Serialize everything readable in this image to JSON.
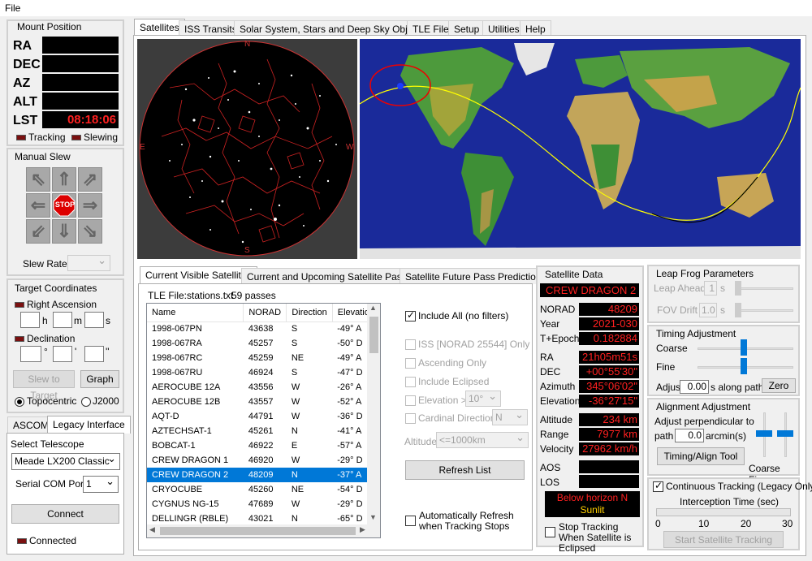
{
  "menu": {
    "file": "File"
  },
  "mount": {
    "title": "Mount Position",
    "ra_label": "RA",
    "dec_label": "DEC",
    "az_label": "AZ",
    "alt_label": "ALT",
    "lst_label": "LST",
    "lst_value": "08:18:06",
    "tracking": "Tracking",
    "slewing": "Slewing"
  },
  "slew": {
    "title": "Manual Slew",
    "stop": "STOP",
    "rate_label": "Slew Rate"
  },
  "target": {
    "title": "Target Coordinates",
    "ra": "Right Ascension",
    "h": "h",
    "m": "m",
    "s": "s",
    "dec": "Declination",
    "deg": "°",
    "min": "'",
    "sec": "''",
    "slew_btn": "Slew to Target",
    "graph_btn": "Graph",
    "topo": "Topocentric",
    "j2000": "J2000"
  },
  "ascom": {
    "tab1": "ASCOM",
    "tab2": "Legacy Interface",
    "select_label": "Select Telescope",
    "telescope": "Meade LX200 Classic",
    "port_label": "Serial COM Port",
    "port": "1",
    "connect": "Connect",
    "connected": "Connected"
  },
  "tabs": [
    "Satellites",
    "ISS Transits",
    "Solar System, Stars and Deep Sky Objects",
    "TLE File",
    "Setup",
    "Utilities",
    "Help"
  ],
  "skymap": {
    "N": "N",
    "S": "S",
    "E": "E",
    "W": "W"
  },
  "list_tabs": [
    "Current Visible Satellites",
    "Current and Upcoming Satellite Passes",
    "Satellite Future Pass Predictions"
  ],
  "tle": {
    "file": "TLE File:stations.txt",
    "passes": "59 passes"
  },
  "table": {
    "headers": [
      "Name",
      "NORAD",
      "Direction",
      "Elevation"
    ],
    "rows": [
      [
        "1998-067PN",
        "43638",
        "S",
        "-49° A"
      ],
      [
        "1998-067RA",
        "45257",
        "S",
        "-50° D"
      ],
      [
        "1998-067RC",
        "45259",
        "NE",
        "-49° A"
      ],
      [
        "1998-067RU",
        "46924",
        "S",
        "-47° D"
      ],
      [
        "AEROCUBE 12A",
        "43556",
        "W",
        "-26° A"
      ],
      [
        "AEROCUBE 12B",
        "43557",
        "W",
        "-52° A"
      ],
      [
        "AQT-D",
        "44791",
        "W",
        "-36° D"
      ],
      [
        "AZTECHSAT-1",
        "45261",
        "N",
        "-41° A"
      ],
      [
        "BOBCAT-1",
        "46922",
        "E",
        "-57° A"
      ],
      [
        "CREW DRAGON 1",
        "46920",
        "W",
        "-29° D"
      ],
      [
        "CREW DRAGON 2",
        "48209",
        "N",
        "-37° A"
      ],
      [
        "CRYOCUBE",
        "45260",
        "NE",
        "-54° D"
      ],
      [
        "CYGNUS NG-15",
        "47689",
        "W",
        "-29° D"
      ],
      [
        "DELLINGR (RBLE)",
        "43021",
        "N",
        "-65° D"
      ]
    ],
    "selected_index": 10
  },
  "filters": {
    "include_all": "Include All (no filters)",
    "iss_only": "ISS [NORAD 25544] Only",
    "ascending": "Ascending Only",
    "eclipsed": "Include Eclipsed",
    "elevation": "Elevation >",
    "elev_val": "10°",
    "cardinal": "Cardinal Direction",
    "card_val": "N",
    "altitude": "Altitude",
    "alt_val": "<=1000km",
    "refresh": "Refresh List",
    "auto_refresh": "Automatically Refresh when Tracking Stops"
  },
  "satdata": {
    "title": "Satellite Data",
    "name": "CREW DRAGON 2",
    "norad_l": "NORAD",
    "norad": "48209",
    "year_l": "Year",
    "year": "2021-030",
    "epoch_l": "T+Epoch",
    "epoch": "0.182884",
    "ra_l": "RA",
    "ra": "21h05m51s",
    "dec_l": "DEC",
    "dec": "+00°55'30\"",
    "az_l": "Azimuth",
    "az": "345°06'02\"",
    "el_l": "Elevation",
    "el": "-36°27'15\"",
    "alt_l": "Altitude",
    "alt": "234 km",
    "range_l": "Range",
    "range": "7977 km",
    "vel_l": "Velocity",
    "vel": "27962 km/h",
    "aos_l": "AOS",
    "los_l": "LOS",
    "status1": "Below horizon N",
    "status2": "Sunlit",
    "stop_eclipsed": "Stop Tracking When Satellite is Eclipsed"
  },
  "leap": {
    "title": "Leap Frog Parameters",
    "ahead": "Leap Ahead",
    "ahead_val": "1",
    "s": "s",
    "fov": "FOV Drift",
    "fov_val": "1.0"
  },
  "timing": {
    "title": "Timing Adjustment",
    "coarse": "Coarse",
    "fine": "Fine",
    "adjust": "Adjust",
    "adjust_val": "0.00",
    "along": "s along path",
    "zero": "Zero"
  },
  "align": {
    "title": "Alignment Adjustment",
    "perp": "Adjust perpendicular to",
    "path": "path",
    "path_val": "0.0",
    "arcmin": "arcmin(s)",
    "tool": "Timing/Align Tool",
    "coarse_fine": "Coarse Fine"
  },
  "cont": {
    "label": "Continuous Tracking (Legacy Only)",
    "interception": "Interception Time (sec)",
    "ticks": [
      "0",
      "10",
      "20",
      "30"
    ],
    "start": "Start Satellite Tracking"
  }
}
